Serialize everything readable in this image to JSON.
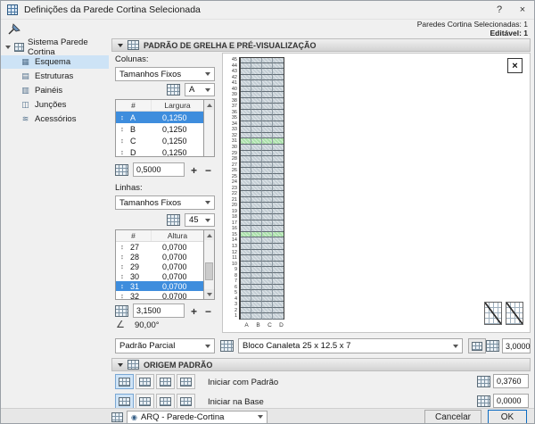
{
  "window": {
    "title": "Definições da Parede Cortina Selecionada",
    "help_glyph": "?",
    "close_glyph": "×"
  },
  "infobar": {
    "selected_count": "Paredes Cortina Selecionadas: 1",
    "editable_count": "Editável: 1"
  },
  "sidebar": {
    "root_label": "Sistema Parede Cortina",
    "root_icon": "▦",
    "items": [
      {
        "label": "Esquema",
        "icon": "▦",
        "icon_name": "scheme-icon",
        "selected": true
      },
      {
        "label": "Estruturas",
        "icon": "▤",
        "icon_name": "frames-icon",
        "selected": false
      },
      {
        "label": "Painéis",
        "icon": "▥",
        "icon_name": "panels-icon",
        "selected": false
      },
      {
        "label": "Junções",
        "icon": "◫",
        "icon_name": "junctions-icon",
        "selected": false
      },
      {
        "label": "Acessórios",
        "icon": "≋",
        "icon_name": "accessories-icon",
        "selected": false
      }
    ]
  },
  "grid_section": {
    "title": "PADRÃO DE GRELHA E PRÉ-VISUALIZAÇÃO",
    "columns": {
      "label": "Colunas:",
      "scheme": "Tamanhos Fixos",
      "selector": "A",
      "table": {
        "headers": [
          "#",
          "Largura"
        ],
        "handle_glyph": "↕",
        "rows": [
          {
            "id": "A",
            "value": "0,1250",
            "selected": true
          },
          {
            "id": "B",
            "value": "0,1250",
            "selected": false
          },
          {
            "id": "C",
            "value": "0,1250",
            "selected": false
          },
          {
            "id": "D",
            "value": "0,1250",
            "selected": false
          }
        ]
      },
      "total": "0,5000"
    },
    "rows": {
      "label": "Linhas:",
      "scheme": "Tamanhos Fixos",
      "selector": "45",
      "table": {
        "headers": [
          "#",
          "Altura"
        ],
        "handle_glyph": "↕",
        "rows": [
          {
            "id": "27",
            "value": "0,0700",
            "selected": false
          },
          {
            "id": "28",
            "value": "0,0700",
            "selected": false
          },
          {
            "id": "29",
            "value": "0,0700",
            "selected": false
          },
          {
            "id": "30",
            "value": "0,0700",
            "selected": false
          },
          {
            "id": "31",
            "value": "0,0700",
            "selected": true
          },
          {
            "id": "32",
            "value": "0,0700",
            "selected": false
          }
        ]
      },
      "total": "3,1500",
      "angle": "90,00°"
    },
    "preview": {
      "row_count": 45,
      "highlighted_rows": [
        15,
        31
      ],
      "column_labels": [
        "A",
        "B",
        "C",
        "D"
      ]
    }
  },
  "pattern_row": {
    "partial": "Padrão Parcial",
    "block": "Bloco Canaleta 25 x 12.5 x 7",
    "thickness": "3,0000"
  },
  "origin_section": {
    "title": "ORIGEM PADRÃO",
    "start_with_pattern_label": "Iniciar com Padrão",
    "start_with_pattern_value": "0,3760",
    "start_at_base_label": "Iniciar na Base",
    "start_at_base_value": "0,0000"
  },
  "footer": {
    "profile": "ARQ - Parede-Cortina",
    "eye_glyph": "◉",
    "cancel": "Cancelar",
    "ok": "OK"
  },
  "glyphs": {
    "plus": "+",
    "minus": "−",
    "angle": "∠"
  },
  "colors": {
    "selection_blue": "#3e8ddd",
    "highlight_green": "#a9e0a9",
    "ok_border": "#0b6bc2"
  }
}
